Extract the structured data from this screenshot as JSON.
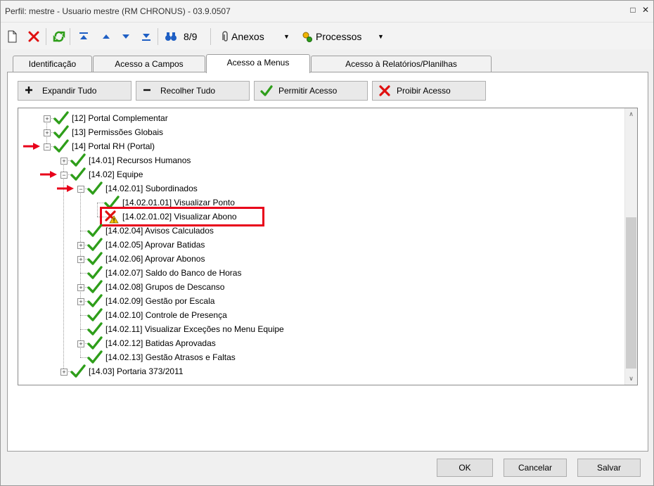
{
  "window": {
    "title": "Perfil: mestre - Usuario mestre (RM CHRONUS) - 03.9.0507",
    "restore_glyph": "□",
    "close_glyph": "✕"
  },
  "toolbar": {
    "record_count": "8/9",
    "anexos_label": "Anexos",
    "processos_label": "Processos",
    "dropdown_glyph": "▼"
  },
  "tabs": [
    {
      "label": "Identificação",
      "active": false
    },
    {
      "label": "Acesso a Campos",
      "active": false
    },
    {
      "label": "Acesso a Menus",
      "active": true
    },
    {
      "label": "Acesso à Relatórios/Planilhas",
      "active": false
    }
  ],
  "actions": {
    "expand": "Expandir Tudo",
    "collapse": "Recolher Tudo",
    "allow": "Permitir Acesso",
    "deny": "Proibir Acesso"
  },
  "tree": {
    "expand_glyph": "+",
    "collapse_glyph": "−",
    "scroll_up_glyph": "∧",
    "scroll_down_glyph": "∨",
    "nodes": [
      {
        "label": "[12] Portal Complementar",
        "state": "allowed",
        "expandable": true,
        "expanded": false
      },
      {
        "label": "[13] Permissões Globais",
        "state": "allowed",
        "expandable": true,
        "expanded": false
      },
      {
        "label": "[14] Portal RH (Portal)",
        "state": "allowed",
        "expandable": true,
        "expanded": true,
        "arrow": true
      },
      {
        "label": "[14.01] Recursos Humanos",
        "state": "allowed",
        "expandable": true,
        "expanded": false
      },
      {
        "label": "[14.02] Equipe",
        "state": "allowed",
        "expandable": true,
        "expanded": true,
        "arrow": true
      },
      {
        "label": "[14.02.01] Subordinados",
        "state": "allowed",
        "expandable": true,
        "expanded": true,
        "arrow": true
      },
      {
        "label": "[14.02.01.01] Visualizar Ponto",
        "state": "allowed",
        "expandable": false
      },
      {
        "label": "[14.02.01.02] Visualizar Abono",
        "state": "denied-warning",
        "expandable": false,
        "highlighted": true
      },
      {
        "label": "[14.02.04] Avisos Calculados",
        "state": "allowed",
        "expandable": false
      },
      {
        "label": "[14.02.05] Aprovar Batidas",
        "state": "allowed",
        "expandable": true,
        "expanded": false
      },
      {
        "label": "[14.02.06] Aprovar Abonos",
        "state": "allowed",
        "expandable": true,
        "expanded": false
      },
      {
        "label": "[14.02.07] Saldo do Banco de Horas",
        "state": "allowed",
        "expandable": false
      },
      {
        "label": "[14.02.08] Grupos de Descanso",
        "state": "allowed",
        "expandable": true,
        "expanded": false
      },
      {
        "label": "[14.02.09] Gestão por Escala",
        "state": "allowed",
        "expandable": true,
        "expanded": false
      },
      {
        "label": "[14.02.10] Controle de Presença",
        "state": "allowed",
        "expandable": false
      },
      {
        "label": "[14.02.11] Visualizar Exceções no Menu Equipe",
        "state": "allowed",
        "expandable": false
      },
      {
        "label": "[14.02.12] Batidas Aprovadas",
        "state": "allowed",
        "expandable": true,
        "expanded": false
      },
      {
        "label": "[14.02.13] Gestão Atrasos e Faltas",
        "state": "allowed",
        "expandable": false
      },
      {
        "label": "[14.03] Portaria 373/2011",
        "state": "allowed",
        "expandable": true,
        "expanded": false
      }
    ]
  },
  "footer": {
    "ok": "OK",
    "cancel": "Cancelar",
    "save": "Salvar"
  },
  "colors": {
    "allowed": "#2e9e1a",
    "denied": "#e01010",
    "warning": "#f2c200",
    "arrow": "#e8001a",
    "toolbar_blue": "#1f5fc4"
  }
}
